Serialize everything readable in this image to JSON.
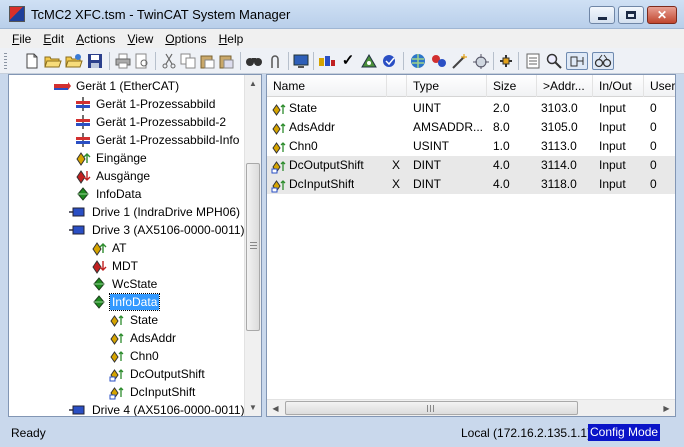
{
  "window": {
    "title": "TcMC2 XFC.tsm - TwinCAT System Manager"
  },
  "menu": [
    "File",
    "Edit",
    "Actions",
    "View",
    "Options",
    "Help"
  ],
  "toolbar_icons": [
    "new-file-icon",
    "open-folder-icon",
    "open-remote-icon",
    "save-icon",
    "print-icon",
    "print-preview-icon",
    "cut-icon",
    "copy-icon",
    "paste-icon",
    "paste-special-icon",
    "find-icon",
    "find-next-icon",
    "monitor-icon",
    "generate-mappings-icon",
    "check-configuration-icon",
    "activate-configuration-icon",
    "restart-icon",
    "choose-target-icon",
    "scan-devices-icon",
    "toggle-free-run-icon",
    "wand-icon",
    "plugin-icon",
    "show-variables-icon",
    "zoom-icon",
    "show-online-data-icon",
    "show-sub-items-icon"
  ],
  "tree": {
    "items": [
      {
        "label": "Gerät 1 (EtherCAT)",
        "icon": "ethercat-device-icon",
        "color": "#d23030"
      },
      {
        "label": "Gerät 1-Prozessabbild",
        "icon": "process-image-icon",
        "color": "#2a4fc4"
      },
      {
        "label": "Gerät 1-Prozessabbild-2",
        "icon": "process-image-icon",
        "color": "#2a4fc4"
      },
      {
        "label": "Gerät 1-Prozessabbild-Info",
        "icon": "process-image-icon",
        "color": "#2a4fc4"
      },
      {
        "label": "Eingänge",
        "icon": "inputs-icon",
        "color": "#d6a400"
      },
      {
        "label": "Ausgänge",
        "icon": "outputs-icon",
        "color": "#c02020"
      },
      {
        "label": "InfoData",
        "icon": "infodata-icon",
        "color": "#1f8a1f"
      },
      {
        "label": "Drive 1 (IndraDrive MPH06)",
        "icon": "drive-box-icon",
        "color": "#2a4fc4"
      },
      {
        "label": "Drive 3 (AX5106-0000-0011)",
        "icon": "drive-box-icon",
        "color": "#2a4fc4"
      },
      {
        "label": "AT",
        "icon": "input-var-folder-icon",
        "color": "#d6a400"
      },
      {
        "label": "MDT",
        "icon": "output-var-folder-icon",
        "color": "#c02020"
      },
      {
        "label": "WcState",
        "icon": "infodata-icon",
        "color": "#1f8a1f"
      },
      {
        "label": "InfoData",
        "icon": "infodata-icon",
        "color": "#1f8a1f",
        "selected": true
      },
      {
        "label": "State",
        "icon": "input-variable-icon",
        "color": "#d6a400"
      },
      {
        "label": "AdsAddr",
        "icon": "input-variable-icon",
        "color": "#d6a400"
      },
      {
        "label": "Chn0",
        "icon": "input-variable-icon",
        "color": "#d6a400"
      },
      {
        "label": "DcOutputShift",
        "icon": "input-variable-linked-icon",
        "color": "#d6a400"
      },
      {
        "label": "DcInputShift",
        "icon": "input-variable-linked-icon",
        "color": "#d6a400"
      },
      {
        "label": "Drive 4 (AX5106-0000-0011)",
        "icon": "drive-box-icon",
        "color": "#2a4fc4"
      }
    ]
  },
  "list": {
    "columns": [
      "Name",
      "",
      "Type",
      "Size",
      ">Addr...",
      "In/Out",
      "User"
    ],
    "rows": [
      {
        "name": "State",
        "icon": "input-variable-icon",
        "x": "",
        "type": "UINT",
        "size": "2.0",
        "addr": "3103.0",
        "inout": "Input",
        "user": "0"
      },
      {
        "name": "AdsAddr",
        "icon": "input-variable-icon",
        "x": "",
        "type": "AMSADDR...",
        "size": "8.0",
        "addr": "3105.0",
        "inout": "Input",
        "user": "0"
      },
      {
        "name": "Chn0",
        "icon": "input-variable-icon",
        "x": "",
        "type": "USINT",
        "size": "1.0",
        "addr": "3113.0",
        "inout": "Input",
        "user": "0"
      },
      {
        "name": "DcOutputShift",
        "icon": "input-variable-linked-icon",
        "x": "X",
        "type": "DINT",
        "size": "4.0",
        "addr": "3114.0",
        "inout": "Input",
        "user": "0"
      },
      {
        "name": "DcInputShift",
        "icon": "input-variable-linked-icon",
        "x": "X",
        "type": "DINT",
        "size": "4.0",
        "addr": "3118.0",
        "inout": "Input",
        "user": "0"
      }
    ]
  },
  "status": {
    "left": "Ready",
    "target": "Local (172.16.2.135.1.1)",
    "mode": "Config Mode"
  }
}
